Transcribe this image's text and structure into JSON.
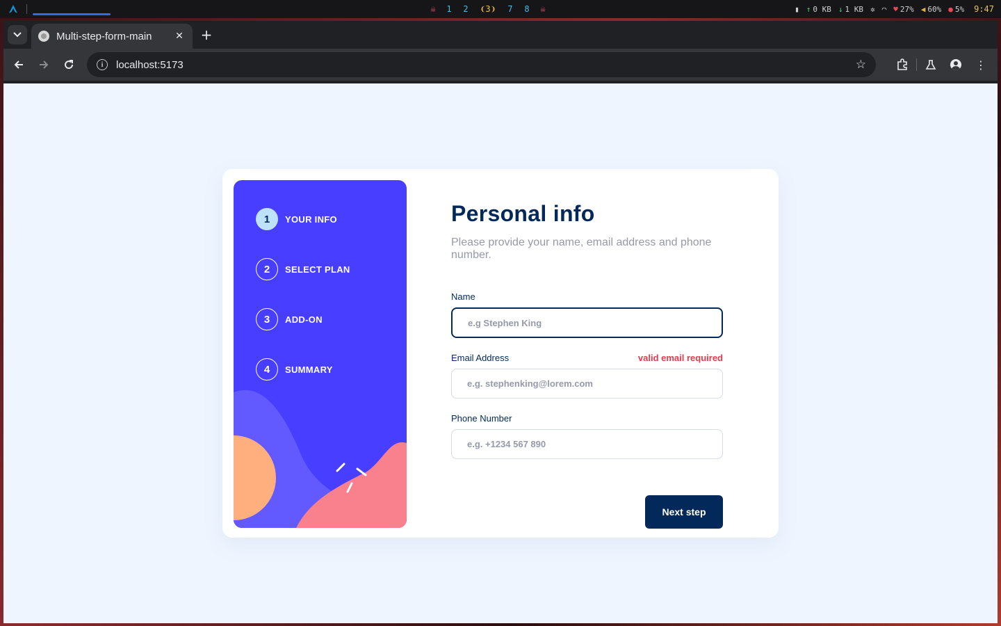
{
  "system_bar": {
    "workspaces": [
      "1",
      "2",
      "3",
      "7",
      "8"
    ],
    "active_workspace": "3",
    "upload": "0 KB",
    "download": "1 KB",
    "cpu": "27%",
    "volume": "60%",
    "memory": "5%",
    "clock": "9:47"
  },
  "browser": {
    "tab_title": "Multi-step-form-main",
    "url": "localhost:5173"
  },
  "sidebar": {
    "steps": [
      {
        "number": "1",
        "label": "YOUR INFO",
        "active": true
      },
      {
        "number": "2",
        "label": "SELECT PLAN",
        "active": false
      },
      {
        "number": "3",
        "label": "ADD-ON",
        "active": false
      },
      {
        "number": "4",
        "label": "SUMMARY",
        "active": false
      }
    ]
  },
  "form": {
    "title": "Personal info",
    "subtitle": "Please provide your name, email address and phone number.",
    "fields": {
      "name": {
        "label": "Name",
        "placeholder": "e.g Stephen King",
        "value": ""
      },
      "email": {
        "label": "Email Address",
        "placeholder": "e.g. stephenking@lorem.com",
        "value": "",
        "error": "valid email required"
      },
      "phone": {
        "label": "Phone Number",
        "placeholder": "e.g. +1234 567 890",
        "value": ""
      }
    },
    "next_button": "Next step"
  },
  "colors": {
    "sidebar_bg": "#483eff",
    "marine_blue": "#022959",
    "error_red": "#ee374a",
    "page_bg": "#eef5ff"
  }
}
